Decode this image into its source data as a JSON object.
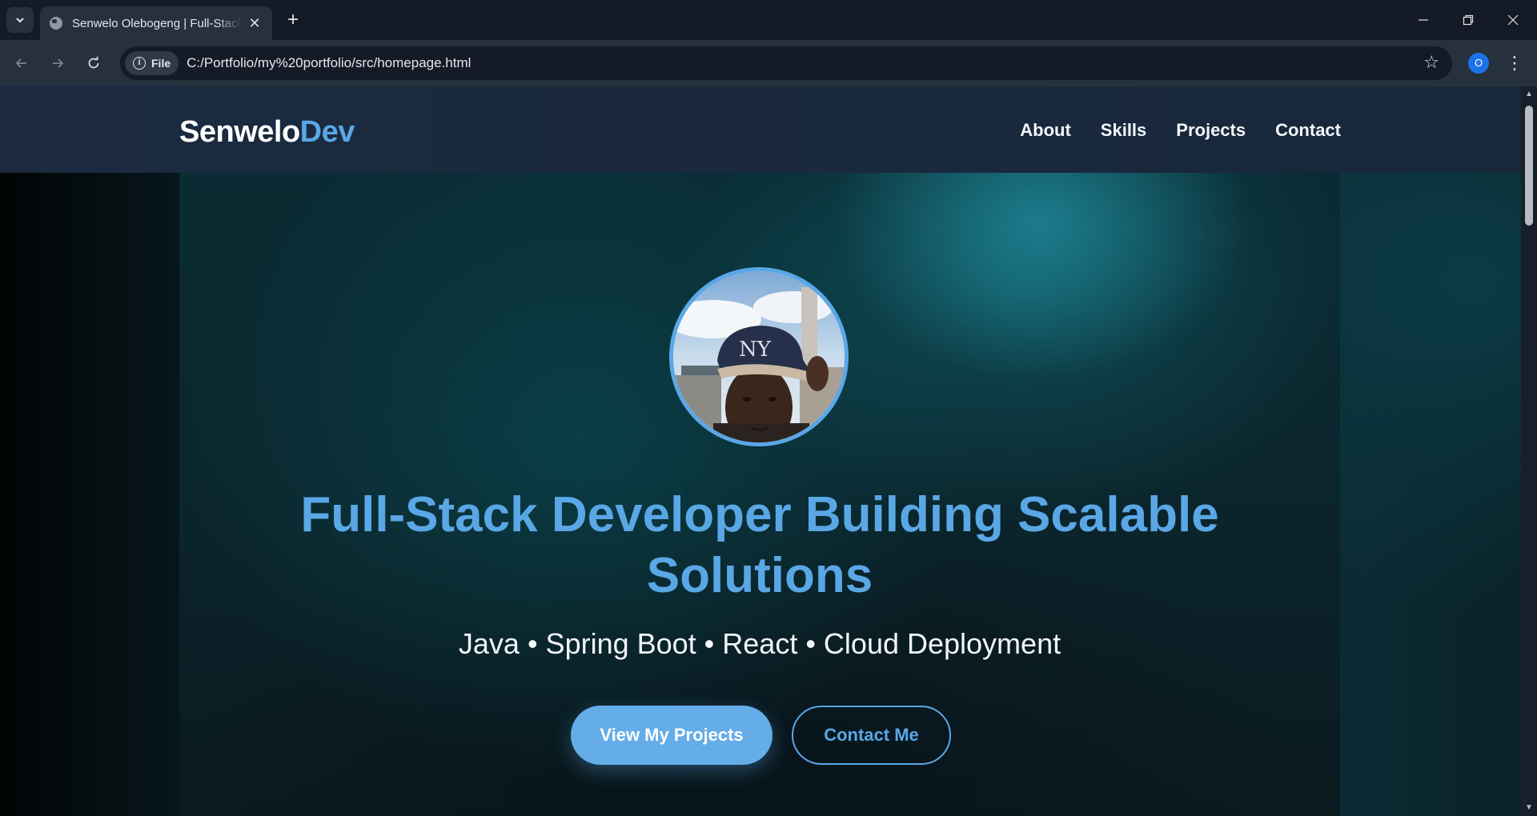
{
  "browser": {
    "tab_title": "Senwelo Olebogeng | Full-Stack Developer",
    "new_tab_symbol": "+",
    "close_symbol": "✕",
    "chip_label": "File",
    "url": "C:/Portfolio/my%20portfolio/src/homepage.html",
    "profile_initial": "O",
    "icons": [
      "tab-list-icon",
      "globe-icon",
      "back-icon",
      "forward-icon",
      "reload-icon",
      "info-icon",
      "star-icon",
      "kebab-menu-icon",
      "minimize-icon",
      "restore-icon",
      "close-icon"
    ]
  },
  "site": {
    "logo_main": "Senwelo",
    "logo_accent": "Dev",
    "nav": [
      "About",
      "Skills",
      "Projects",
      "Contact"
    ]
  },
  "hero": {
    "headline_line1": "Full-Stack Developer Building Scalable",
    "headline_line2": "Solutions",
    "subline": "Java • Spring Boot • React • Cloud Deployment",
    "primary_button": "View My Projects",
    "secondary_button": "Contact Me"
  },
  "colors": {
    "accent": "#5aa7e6",
    "header_bg": "#1b2a40",
    "chrome_bg": "#27303d"
  }
}
